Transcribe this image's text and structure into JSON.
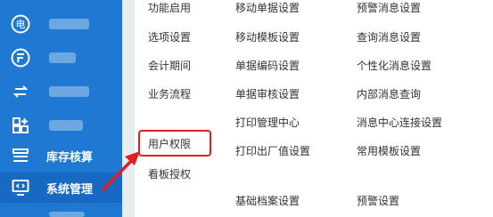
{
  "sidebar": {
    "items": [
      {
        "icon": "electric-icon",
        "label": ""
      },
      {
        "icon": "finance-icon",
        "label": ""
      },
      {
        "icon": "transfer-icon",
        "label": ""
      },
      {
        "icon": "apps-icon",
        "label": ""
      },
      {
        "icon": "inventory-icon",
        "label": "库存核算"
      },
      {
        "icon": "system-admin-icon",
        "label": "系统管理",
        "active": true
      }
    ]
  },
  "menu": {
    "col1": [
      "功能启用",
      "选项设置",
      "会计期间",
      "业务流程"
    ],
    "col1_lower": [
      "用户权限",
      "看板授权"
    ],
    "col2": [
      "移动单据设置",
      "移动模板设置",
      "单据编码设置",
      "单据审核设置",
      "打印管理中心",
      "打印出厂值设置",
      "基础档案设置"
    ],
    "col3": [
      "预警消息设置",
      "查询消息设置",
      "个性化消息设置",
      "内部消息查询",
      "消息中心连接设置",
      "常用模板设置",
      "预警设置"
    ]
  },
  "annotation": {
    "highlight_color": "#e02020",
    "highlighted_item": "用户权限"
  },
  "colors": {
    "sidebar_bg": "#1f78d1",
    "sidebar_active": "#1769c2",
    "text": "#333333"
  }
}
